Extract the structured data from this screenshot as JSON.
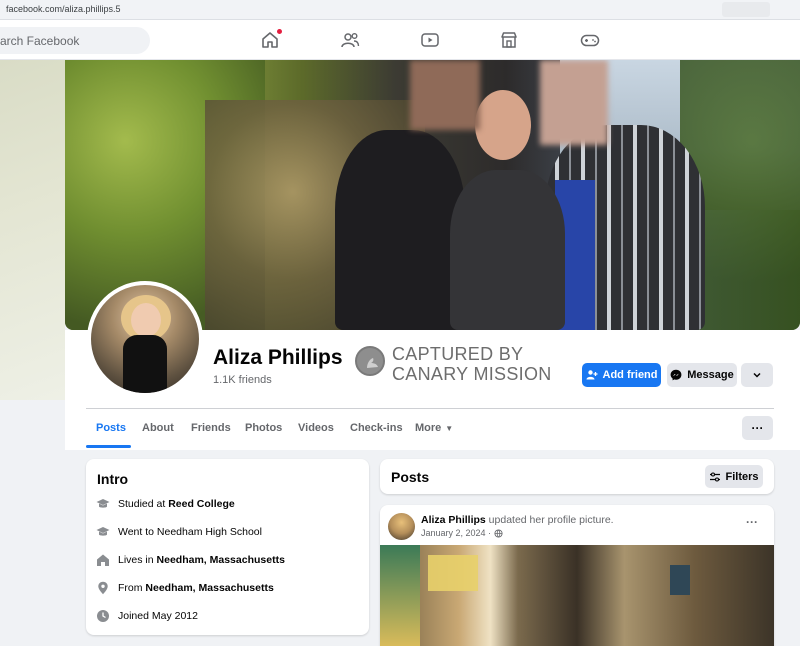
{
  "browser": {
    "url": "facebook.com/aliza.phillips.5"
  },
  "topnav": {
    "search_placeholder": "arch Facebook",
    "icons": [
      "home-icon",
      "friends-icon",
      "video-icon",
      "marketplace-icon",
      "gaming-icon"
    ]
  },
  "profile": {
    "name": "Aliza Phillips",
    "friends": "1.1K friends",
    "stamp_line1": "CAPTURED BY",
    "stamp_line2": "CANARY MISSION",
    "add_friend": "Add friend",
    "message": "Message"
  },
  "tabs": [
    {
      "label": "Posts"
    },
    {
      "label": "About"
    },
    {
      "label": "Friends"
    },
    {
      "label": "Photos"
    },
    {
      "label": "Videos"
    },
    {
      "label": "Check-ins"
    },
    {
      "label": "More"
    }
  ],
  "intro": {
    "title": "Intro",
    "items": [
      {
        "prefix": "Studied at ",
        "bold": "Reed College",
        "icon": "graduation-cap-icon"
      },
      {
        "prefix": "Went to Needham High School",
        "bold": "",
        "icon": "graduation-cap-icon"
      },
      {
        "prefix": "Lives in ",
        "bold": "Needham, Massachusetts",
        "icon": "home-icon"
      },
      {
        "prefix": "From ",
        "bold": "Needham, Massachusetts",
        "icon": "location-pin-icon"
      },
      {
        "prefix": "Joined May 2012",
        "bold": "",
        "icon": "clock-icon"
      }
    ]
  },
  "posts": {
    "title": "Posts",
    "filters": "Filters",
    "first": {
      "author": "Aliza Phillips",
      "action": " updated her profile picture.",
      "date": "January 2, 2024 ·"
    }
  },
  "colors": {
    "accent": "#1877f2",
    "background": "#f0f2f5"
  }
}
